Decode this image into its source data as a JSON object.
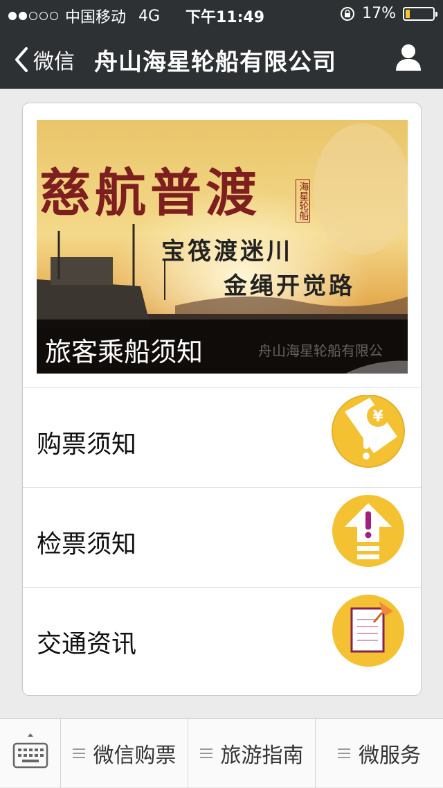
{
  "status": {
    "carrier": "中国移动",
    "network": "4G",
    "time": "下午11:49",
    "battery": "17%",
    "battery_level": 0.17,
    "signal_bars": 2
  },
  "navbar": {
    "back_label": "微信",
    "title": "舟山海星轮船有限公司"
  },
  "banner": {
    "headline": "慈航普渡",
    "poem_line1": "宝筏渡迷川",
    "poem_line2": "金绳开觉路",
    "seal": "海星轮船",
    "caption": "旅客乘船须知",
    "watermark": "舟山海星轮船有限公"
  },
  "list": [
    {
      "label": "购票须知",
      "icon": "ticket-warning-icon"
    },
    {
      "label": "检票须知",
      "icon": "upload-alert-icon"
    },
    {
      "label": "交通资讯",
      "icon": "notepad-pin-icon"
    }
  ],
  "menu": {
    "items": [
      {
        "label": "微信购票"
      },
      {
        "label": "旅游指南"
      },
      {
        "label": "微服务"
      }
    ]
  },
  "colors": {
    "bar": "#2e3133",
    "icon_yellow": "#f3c131",
    "battery": "#f7c531"
  }
}
